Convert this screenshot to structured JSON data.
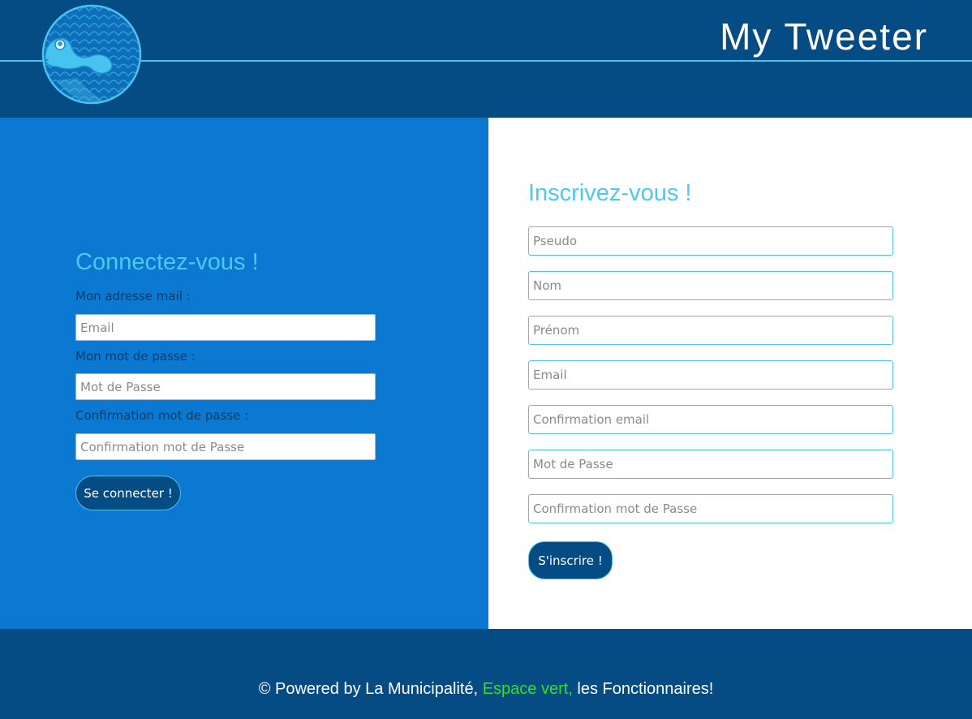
{
  "header": {
    "title": "My Tweeter",
    "logo_icon": "pangolin-logo-icon"
  },
  "login": {
    "title": "Connectez-vous !",
    "email_label": "Mon adresse mail :",
    "email_placeholder": "Email",
    "password_label": "Mon mot de passe :",
    "password_placeholder": "Mot de Passe",
    "confirm_label": "Confirmation mot de passe :",
    "confirm_placeholder": "Confirmation mot de Passe",
    "button_label": "Se connecter !"
  },
  "signup": {
    "title": "Inscrivez-vous !",
    "fields": [
      {
        "placeholder": "Pseudo"
      },
      {
        "placeholder": "Nom"
      },
      {
        "placeholder": "Prénom"
      },
      {
        "placeholder": "Email"
      },
      {
        "placeholder": "Confirmation email"
      },
      {
        "placeholder": "Mot de Passe"
      },
      {
        "placeholder": "Confirmation mot de Passe"
      }
    ],
    "button_label": "S'inscrire !"
  },
  "footer": {
    "text_before": "© Powered by La Municipalité,",
    "text_green": "Espace vert,",
    "text_after": "les Fonctionnaires!"
  },
  "colors": {
    "header_bg": "#054c84",
    "left_panel_bg": "#0b78d1",
    "accent": "#4ec1ec",
    "title_color": "#4ec8ee",
    "footer_green": "#2ee02e"
  }
}
